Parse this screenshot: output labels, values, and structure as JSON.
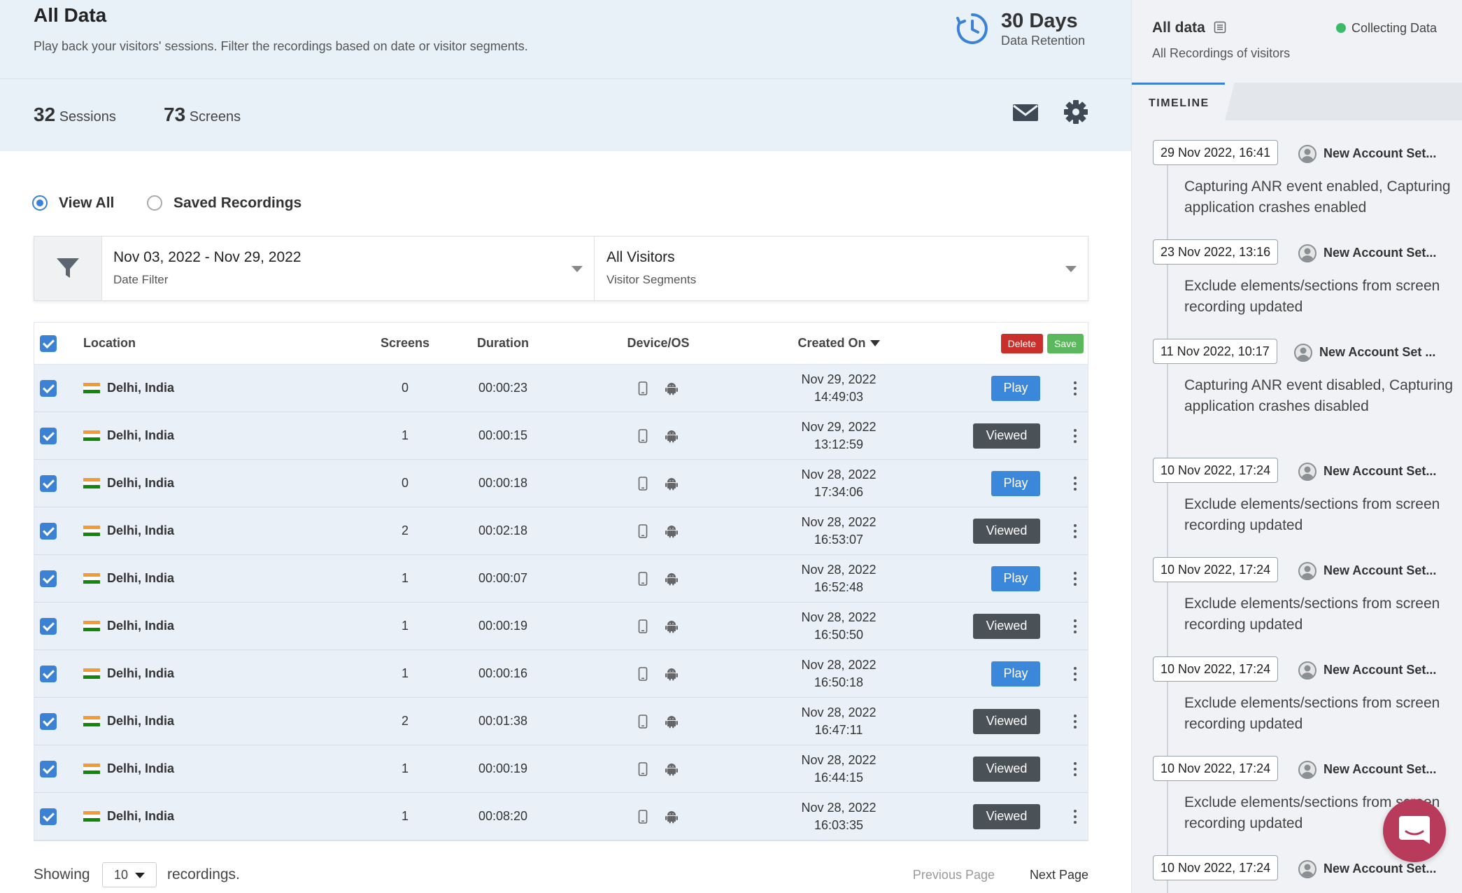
{
  "header": {
    "title": "All Data",
    "subtitle": "Play back your visitors' sessions. Filter the recordings based on date or visitor segments.",
    "retention_value": "30 Days",
    "retention_label": "Data Retention",
    "sessions_count": "32",
    "sessions_label": "Sessions",
    "screens_count": "73",
    "screens_label": "Screens",
    "mail_icon": "mail-icon",
    "settings_icon": "gear-icon"
  },
  "view_options": {
    "view_all": "View All",
    "saved": "Saved Recordings",
    "selected": "View All"
  },
  "filters": {
    "date_value": "Nov 03, 2022 - Nov 29, 2022",
    "date_label": "Date Filter",
    "segment_value": "All Visitors",
    "segment_label": "Visitor Segments"
  },
  "table": {
    "columns": [
      "Location",
      "Screens",
      "Duration",
      "Device/OS",
      "Created On"
    ],
    "delete_label": "Delete",
    "save_label": "Save",
    "rows": [
      {
        "location": "Delhi, India",
        "screens": "0",
        "duration": "00:00:23",
        "date": "Nov 29, 2022",
        "time": "14:49:03",
        "action": "Play"
      },
      {
        "location": "Delhi, India",
        "screens": "1",
        "duration": "00:00:15",
        "date": "Nov 29, 2022",
        "time": "13:12:59",
        "action": "Viewed"
      },
      {
        "location": "Delhi, India",
        "screens": "0",
        "duration": "00:00:18",
        "date": "Nov 28, 2022",
        "time": "17:34:06",
        "action": "Play"
      },
      {
        "location": "Delhi, India",
        "screens": "2",
        "duration": "00:02:18",
        "date": "Nov 28, 2022",
        "time": "16:53:07",
        "action": "Viewed"
      },
      {
        "location": "Delhi, India",
        "screens": "1",
        "duration": "00:00:07",
        "date": "Nov 28, 2022",
        "time": "16:52:48",
        "action": "Play"
      },
      {
        "location": "Delhi, India",
        "screens": "1",
        "duration": "00:00:19",
        "date": "Nov 28, 2022",
        "time": "16:50:50",
        "action": "Viewed"
      },
      {
        "location": "Delhi, India",
        "screens": "1",
        "duration": "00:00:16",
        "date": "Nov 28, 2022",
        "time": "16:50:18",
        "action": "Play"
      },
      {
        "location": "Delhi, India",
        "screens": "2",
        "duration": "00:01:38",
        "date": "Nov 28, 2022",
        "time": "16:47:11",
        "action": "Viewed"
      },
      {
        "location": "Delhi, India",
        "screens": "1",
        "duration": "00:00:19",
        "date": "Nov 28, 2022",
        "time": "16:44:15",
        "action": "Viewed"
      },
      {
        "location": "Delhi, India",
        "screens": "1",
        "duration": "00:08:20",
        "date": "Nov 28, 2022",
        "time": "16:03:35",
        "action": "Viewed"
      }
    ]
  },
  "footer": {
    "showing": "Showing",
    "page_size": "10",
    "recordings": "recordings.",
    "prev": "Previous Page",
    "next": "Next Page"
  },
  "sidebar": {
    "title": "All data",
    "subtitle": "All Recordings of visitors",
    "status": "Collecting Data",
    "tab": "TIMELINE",
    "entries": [
      {
        "date": "29 Nov 2022, 16:41",
        "user": "New Account Set...",
        "text": "Capturing ANR event enabled, Capturing application crashes enabled"
      },
      {
        "date": "23 Nov 2022, 13:16",
        "user": "New Account Set...",
        "text": "Exclude elements/sections from screen recording updated"
      },
      {
        "date": "11 Nov 2022, 10:17",
        "user": "New Account Set ...",
        "text": "Capturing ANR event disabled, Capturing application crashes disabled"
      },
      {
        "date": "10 Nov 2022, 17:24",
        "user": "New Account Set...",
        "text": "Exclude elements/sections from screen recording updated"
      },
      {
        "date": "10 Nov 2022, 17:24",
        "user": "New Account Set...",
        "text": "Exclude elements/sections from screen recording updated"
      },
      {
        "date": "10 Nov 2022, 17:24",
        "user": "New Account Set...",
        "text": "Exclude elements/sections from screen recording updated"
      },
      {
        "date": "10 Nov 2022, 17:24",
        "user": "New Account Set...",
        "text": "Exclude elements/sections from screen recording updated"
      },
      {
        "date": "10 Nov 2022, 17:24",
        "user": "New Account Set...",
        "text": ""
      }
    ]
  },
  "colors": {
    "accent": "#3b82d6",
    "viewed": "#4a5258",
    "delete": "#c9302c",
    "save": "#5cb85c",
    "chat": "#b93b5b"
  }
}
